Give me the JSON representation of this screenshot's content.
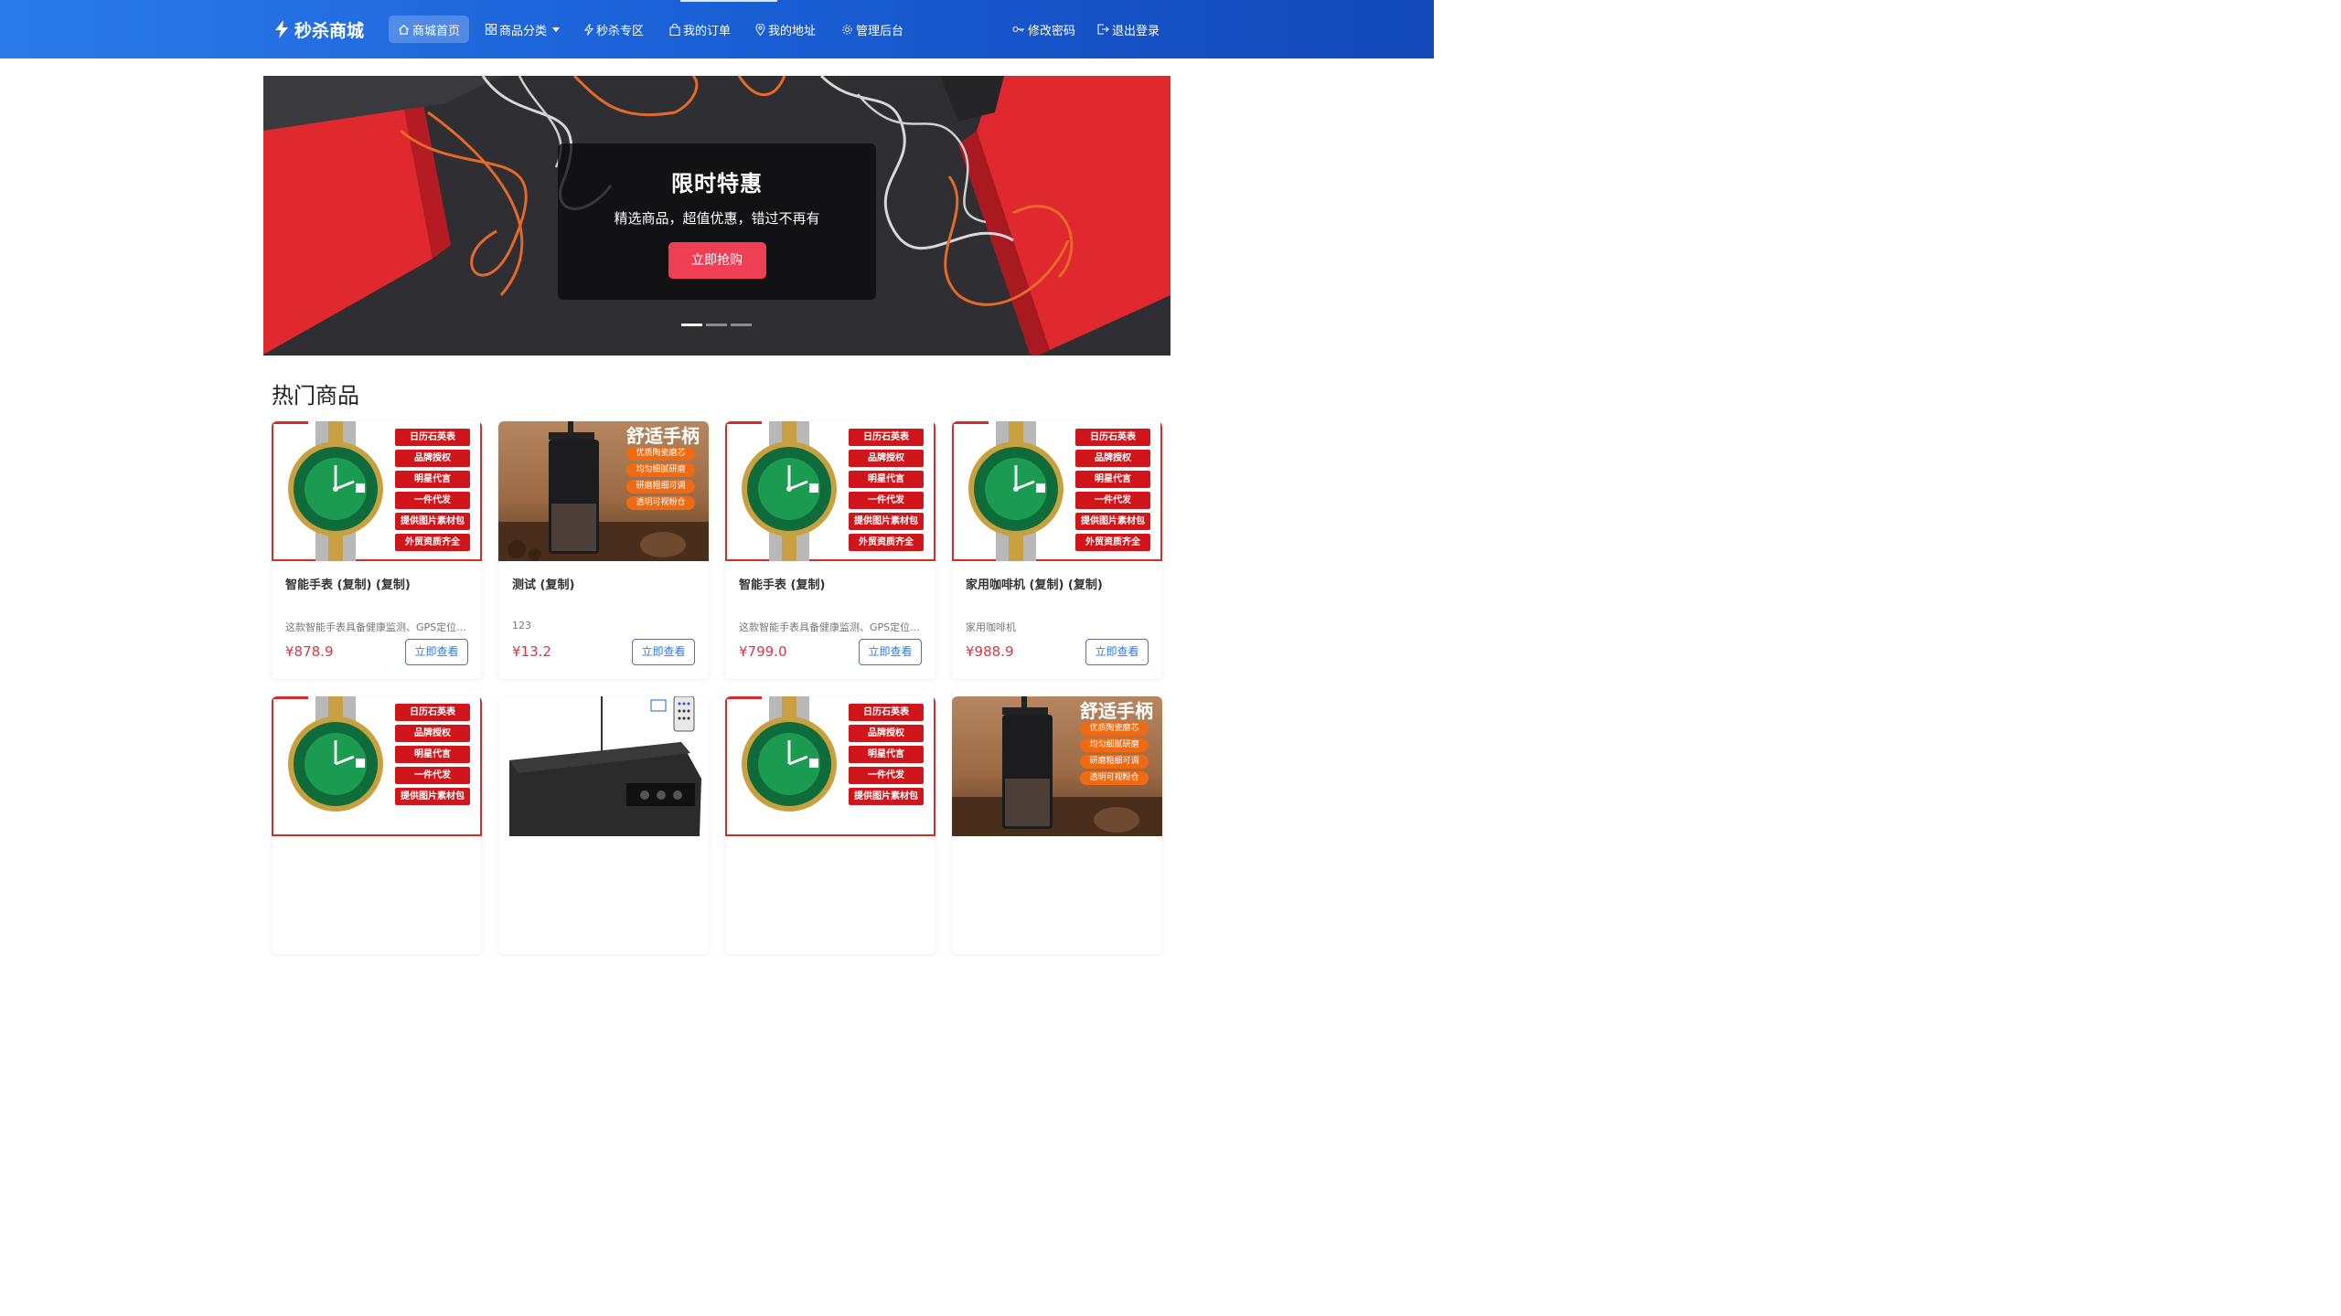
{
  "brand": {
    "name": "秒杀商城",
    "icon": "lightning-icon"
  },
  "nav": {
    "items": [
      {
        "label": "商城首页",
        "icon": "home-icon",
        "active": true
      },
      {
        "label": "商品分类",
        "icon": "grid-icon",
        "dropdown": true
      },
      {
        "label": "秒杀专区",
        "icon": "lightning-icon"
      },
      {
        "label": "我的订单",
        "icon": "bag-icon"
      },
      {
        "label": "我的地址",
        "icon": "location-icon"
      },
      {
        "label": "管理后台",
        "icon": "gear-icon"
      }
    ],
    "right": [
      {
        "label": "修改密码",
        "icon": "key-icon"
      },
      {
        "label": "退出登录",
        "icon": "logout-icon"
      }
    ]
  },
  "carousel": {
    "title": "限时特惠",
    "subtitle": "精选商品，超值优惠，错过不再有",
    "button": "立即抢购",
    "slides": 3,
    "active_slide": 1
  },
  "section": {
    "title": "热门商品"
  },
  "image_tags": {
    "watch": [
      "日历石英表",
      "品牌授权",
      "明星代言",
      "一件代发",
      "提供图片素材包",
      "外贸资质齐全"
    ],
    "grinder_title": "舒适手柄",
    "grinder": [
      "优质陶瓷磨芯",
      "均匀细腻研磨",
      "研磨粗细可调",
      "透明可视粉仓"
    ]
  },
  "products": [
    {
      "name": "智能手表 (复制) (复制)",
      "desc": "这款智能手表具备健康监测、GPS定位等功能",
      "price": "¥878.9",
      "button": "立即查看",
      "image": "watch"
    },
    {
      "name": "测试 (复制)",
      "desc": "123",
      "price": "¥13.2",
      "button": "立即查看",
      "image": "grinder"
    },
    {
      "name": "智能手表 (复制)",
      "desc": "这款智能手表具备健康监测、GPS定位等功能",
      "price": "¥799.0",
      "button": "立即查看",
      "image": "watch"
    },
    {
      "name": "家用咖啡机 (复制) (复制)",
      "desc": "家用咖啡机",
      "price": "¥988.9",
      "button": "立即查看",
      "image": "watch"
    },
    {
      "image": "watch"
    },
    {
      "image": "amplifier"
    },
    {
      "image": "watch"
    },
    {
      "image": "grinder"
    }
  ],
  "colors": {
    "nav": "#1a5fd6",
    "accent": "#f03e55",
    "price": "#dc3545",
    "link": "#2a7bea"
  }
}
